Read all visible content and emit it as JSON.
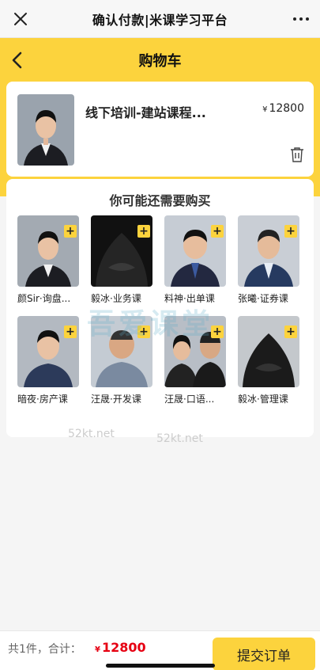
{
  "topbar": {
    "title": "确认付款|米课学习平台"
  },
  "navbar": {
    "title": "购物车"
  },
  "cart": {
    "course_title": "线下培训-建站课程...",
    "currency": "¥",
    "price": "12800"
  },
  "recommend": {
    "title": "你可能还需要购买",
    "items": [
      {
        "label": "颜Sir·询盘..."
      },
      {
        "label": "毅冰·业务课"
      },
      {
        "label": "料神·出单课"
      },
      {
        "label": "张曦·证券课"
      },
      {
        "label": "暗夜·房产课"
      },
      {
        "label": "汪晟·开发课"
      },
      {
        "label": "汪晟·口语..."
      },
      {
        "label": "毅冰·管理课"
      }
    ]
  },
  "watermarks": [
    "52kt.net",
    "52kt.net",
    "吾爱课堂"
  ],
  "bottom": {
    "count_text": "共1件，合计：",
    "currency": "¥",
    "total": "12800",
    "submit_label": "提交订单"
  },
  "colors": {
    "brand_yellow": "#fcd33d",
    "price_red": "#e60012"
  },
  "icons": {
    "close": "close-icon",
    "more": "more-icon",
    "back": "back-icon",
    "trash": "trash-icon",
    "plus": "plus-icon"
  }
}
